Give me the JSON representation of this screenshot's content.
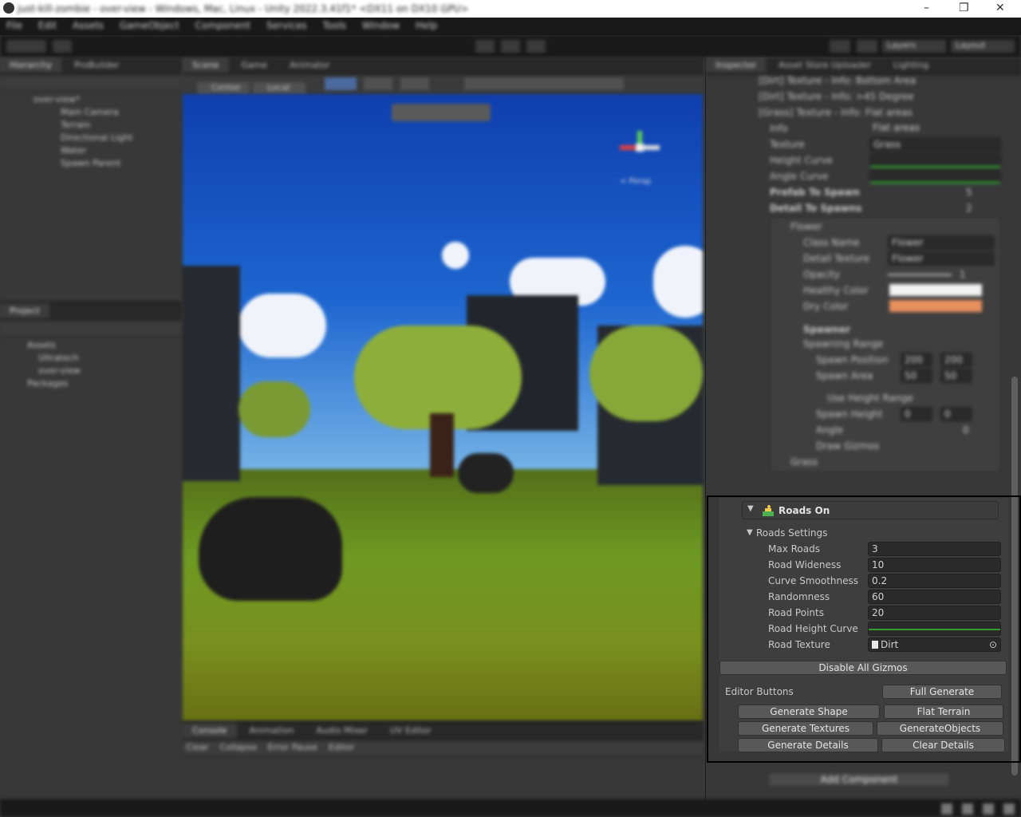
{
  "window": {
    "title": "just-kill-zombie - over-view - Windows, Mac, Linux - Unity 2022.3.41f1* <DX11 on DX10 GPU>",
    "min_icon": "minimize-icon",
    "max_icon": "maximize-icon",
    "close_icon": "close-icon"
  },
  "menu": [
    "File",
    "Edit",
    "Assets",
    "GameObject",
    "Component",
    "Services",
    "Tools",
    "Window",
    "Help"
  ],
  "toolbar": {
    "layers_label": "Layers",
    "layout_label": "Layout"
  },
  "hierarchy": {
    "tabs": [
      "Hierarchy",
      "ProBuilder"
    ],
    "scene_name": "over-view*",
    "items": [
      "Main Camera",
      "Terrain",
      "Directional Light",
      "Water",
      "Spawn Parent"
    ]
  },
  "project": {
    "tab": "Project",
    "items": [
      "Assets",
      "Ultratech",
      "over-view",
      "Packages"
    ]
  },
  "center": {
    "tabs": [
      "Scene",
      "Game",
      "Animator"
    ],
    "scene_toolbar": [
      "Center",
      "Local"
    ],
    "gizmo_label": "< Persp",
    "bottom_tabs": [
      "Console",
      "Animation",
      "Audio Mixer",
      "UV Editor"
    ],
    "console_buttons": [
      "Clear",
      "Collapse",
      "Error Pause",
      "Editor"
    ]
  },
  "inspector": {
    "tabs": [
      "Inspector",
      "Asset Store Uploader",
      "Lighting"
    ],
    "upper_rows": [
      "[Dirt] Texture - Info: Bottom Area",
      "[Dirt] Texture - Info: >45 Degree",
      "[Grass] Texture - Info: Flat areas"
    ],
    "info_label": "Info",
    "info_value": "Flat areas",
    "texture_label": "Texture",
    "texture_value": "Grass",
    "height_curve_label": "Height Curve",
    "angle_curve_label": "Angle Curve",
    "prefab_label": "Prefab To Spawn",
    "prefab_count": "5",
    "detail_label": "Detail To Spawns",
    "detail_count": "2",
    "flower_label": "Flower",
    "class_name_label": "Class Name",
    "class_name_value": "Flower",
    "detail_texture_label": "Detail Texture",
    "detail_texture_value": "Flower",
    "opacity_label": "Opacity",
    "opacity_value": "1",
    "healthy_color_label": "Healthy Color",
    "dry_color_label": "Dry Color",
    "spawner_label": "Spawner",
    "spawning_range_label": "Spawning Range",
    "spawn_position_label": "Spawn Position",
    "spawn_position_x": "200",
    "spawn_position_y": "200",
    "spawn_area_label": "Spawn Area",
    "spawn_area_x": "50",
    "spawn_area_y": "50",
    "use_height_label": "Use Height Range",
    "spawn_height_label": "Spawn Height",
    "spawn_height_x": "0",
    "spawn_height_y": "0",
    "angle_label": "Angle",
    "angle_value": "0",
    "draw_gizmos_label": "Draw Gizmos",
    "grass_label": "Grass",
    "add_component_label": "Add Component",
    "colors": {
      "healthy": "#f2f2f2",
      "dry": "#e8905e",
      "curve": "#2fc42f"
    }
  },
  "roads": {
    "header": "Roads On",
    "settings_label": "Roads Settings",
    "fields": [
      {
        "label": "Max Roads",
        "value": "3"
      },
      {
        "label": "Road Wideness",
        "value": "10"
      },
      {
        "label": "Curve Smoothness",
        "value": "0.2"
      },
      {
        "label": "Randomness",
        "value": "60"
      },
      {
        "label": "Road Points",
        "value": "20"
      }
    ],
    "height_curve_label": "Road Height Curve",
    "texture_label": "Road Texture",
    "texture_value": "Dirt",
    "disable_gizmos": "Disable All Gizmos",
    "editor_buttons_label": "Editor Buttons",
    "full_generate": "Full Generate",
    "generate_shape": "Generate Shape",
    "flat_terrain": "Flat Terrain",
    "generate_textures": "Generate Textures",
    "generate_objects": "GenerateObjects",
    "generate_details": "Generate Details",
    "clear_details": "Clear Details"
  }
}
